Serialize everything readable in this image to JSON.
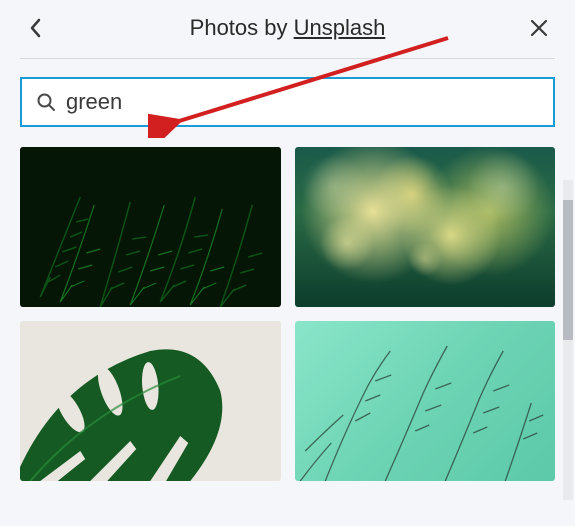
{
  "header": {
    "title_prefix": "Photos by ",
    "provider": "Unsplash"
  },
  "search": {
    "value": "green",
    "placeholder": "Search"
  },
  "results": [
    {
      "alt": "dark green fern leaves"
    },
    {
      "alt": "green grass bokeh lights"
    },
    {
      "alt": "monstera leaf on light background"
    },
    {
      "alt": "bare twigs on mint green wall"
    }
  ],
  "colors": {
    "accent": "#1a9bd7",
    "annotation": "#d21f1f"
  }
}
